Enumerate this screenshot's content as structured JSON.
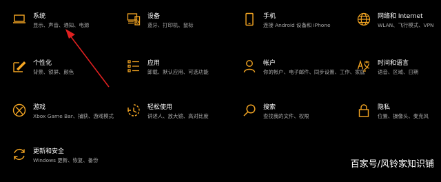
{
  "accent": "#F5A623",
  "settings": [
    {
      "title": "系统",
      "desc": "显示、声音、通知、电源",
      "icon": "laptop-icon"
    },
    {
      "title": "设备",
      "desc": "蓝牙、打印机、鼠标",
      "icon": "devices-icon"
    },
    {
      "title": "手机",
      "desc": "连接 Android 设备和 iPhone",
      "icon": "phone-icon"
    },
    {
      "title": "网络和 Internet",
      "desc": "WLAN、飞行模式、VPN",
      "icon": "globe-icon"
    },
    {
      "title": "个性化",
      "desc": "背景、锁屏、颜色",
      "icon": "personalization-icon"
    },
    {
      "title": "应用",
      "desc": "卸载、默认应用、可选功能",
      "icon": "apps-list-icon"
    },
    {
      "title": "帐户",
      "desc": "你的帐户、电子邮件、同步设置、工作、家庭",
      "icon": "person-icon"
    },
    {
      "title": "时间和语言",
      "desc": "语音、区域、日期",
      "icon": "time-language-icon"
    },
    {
      "title": "游戏",
      "desc": "Xbox Game Bar、捕获、游戏模式",
      "icon": "xbox-icon"
    },
    {
      "title": "轻松使用",
      "desc": "讲述人、放大镜、高对比度",
      "icon": "ease-of-access-icon"
    },
    {
      "title": "搜索",
      "desc": "查找我的文件、权限",
      "icon": "search-icon"
    },
    {
      "title": "隐私",
      "desc": "位置、摄像头、麦克风",
      "icon": "lock-icon"
    },
    {
      "title": "更新和安全",
      "desc": "Windows 更新、恢复、备份",
      "icon": "update-icon"
    }
  ],
  "watermark": "百家号/风铃家知识铺"
}
